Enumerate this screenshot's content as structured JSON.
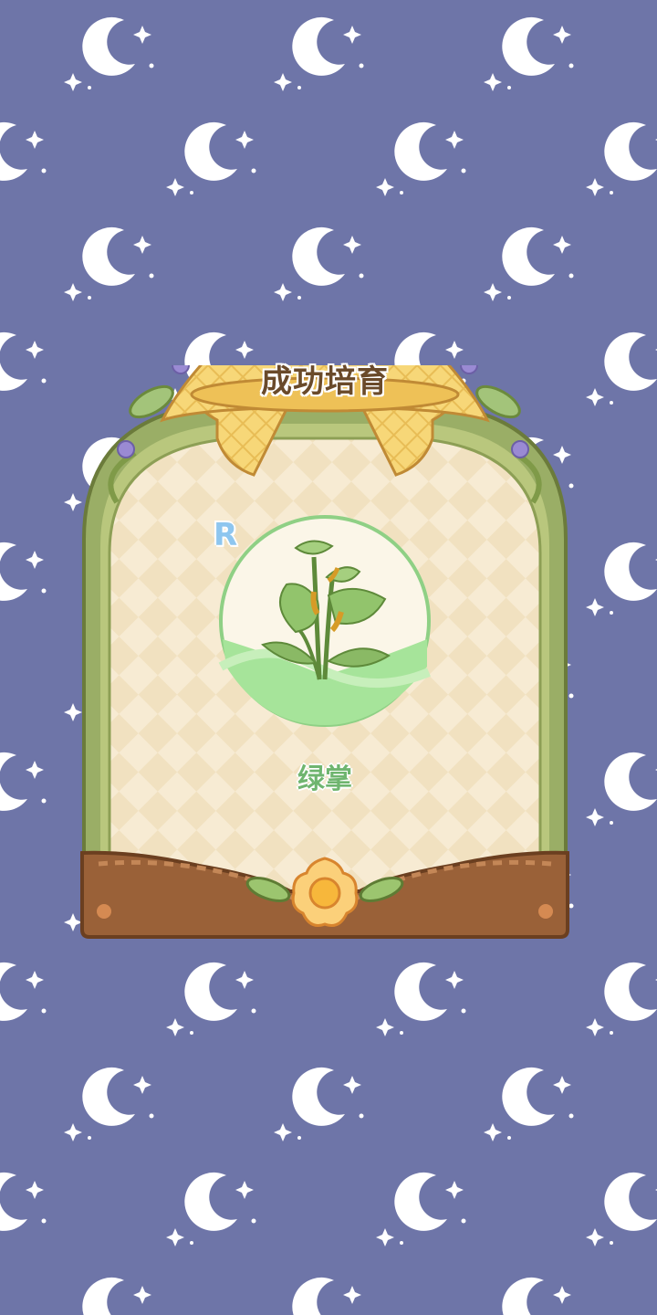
{
  "dialog": {
    "title": "成功培育",
    "rarity": "R",
    "plant_name": "绿掌"
  },
  "colors": {
    "background": "#6e75a8",
    "frame_green": "#9fb26a",
    "bow_yellow": "#f5d57a",
    "base_brown": "#9a6138"
  },
  "icons": [
    "moon-pattern",
    "plant-illustration",
    "bow-ribbon",
    "flower-ornament"
  ]
}
